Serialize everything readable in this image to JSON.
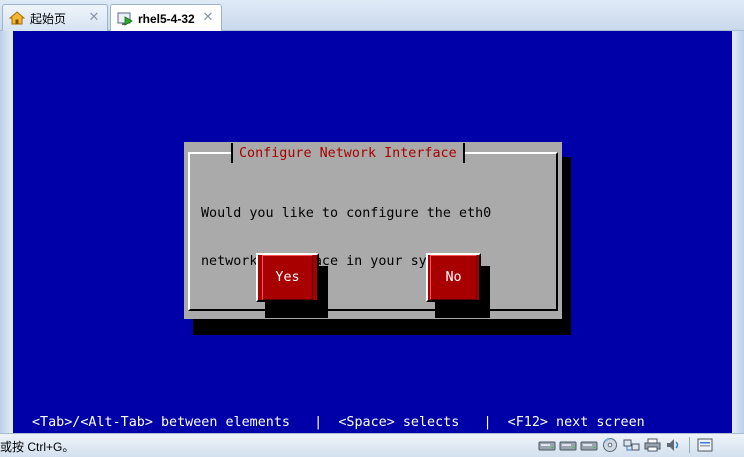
{
  "tabs": [
    {
      "label": "起始页",
      "icon": "home-icon",
      "active": false
    },
    {
      "label": "rhel5-4-32",
      "icon": "vm-running-icon",
      "active": true
    }
  ],
  "dialog": {
    "title": "Configure Network Interface",
    "message_line1": "Would you like to configure the eth0",
    "message_line2": "network interface in your system?",
    "yes_label": "Yes",
    "no_label": "No"
  },
  "hint_bar": "<Tab>/<Alt-Tab> between elements   |  <Space> selects   |  <F12> next screen",
  "status": {
    "text": "或按 Ctrl+G。",
    "device_icons": [
      "hard-disk-icon",
      "hard-disk-icon",
      "hard-disk-icon",
      "cdrom-icon",
      "network-icon",
      "printer-icon",
      "sound-icon",
      "message-icon"
    ]
  },
  "colors": {
    "console_bg": "#0000a8",
    "dialog_bg": "#aaaaaa",
    "dialog_title": "#a80000",
    "button_bg": "#a80000"
  }
}
